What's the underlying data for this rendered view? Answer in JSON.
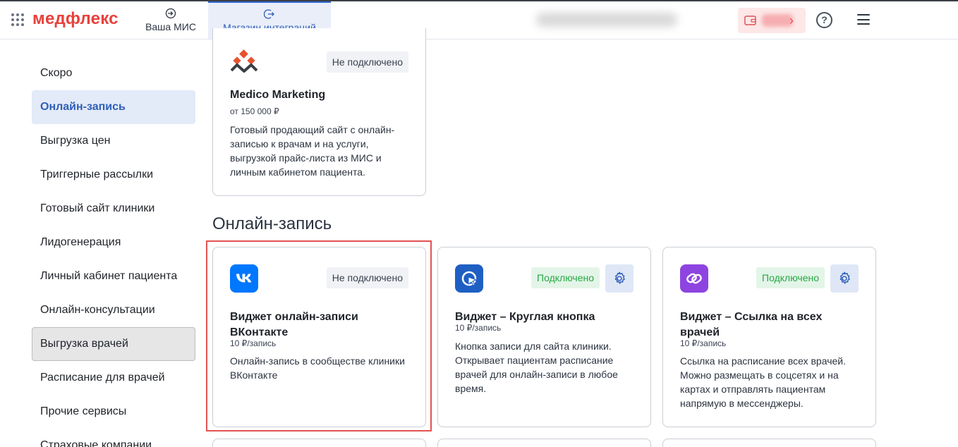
{
  "header": {
    "logo": "медфлекс",
    "tabs": [
      {
        "label": "Ваша МИС",
        "icon": "login-icon"
      },
      {
        "label": "Магазин интеграций",
        "icon": "logout-icon",
        "active": true
      }
    ]
  },
  "sidebar": {
    "items": [
      {
        "label": "Скоро"
      },
      {
        "label": "Онлайн-запись",
        "active": true
      },
      {
        "label": "Выгрузка цен"
      },
      {
        "label": "Триггерные рассылки"
      },
      {
        "label": "Готовый сайт клиники"
      },
      {
        "label": "Лидогенерация"
      },
      {
        "label": "Личный кабинет пациента"
      },
      {
        "label": "Онлайн-консультации"
      },
      {
        "label": "Выгрузка врачей",
        "hovered": true
      },
      {
        "label": "Расписание для врачей"
      },
      {
        "label": "Прочие сервисы"
      },
      {
        "label": "Страховые компании"
      }
    ]
  },
  "main": {
    "top_card": {
      "status": "Не подключено",
      "title": "Medico Marketing",
      "price": "от 150 000 ₽",
      "description": "Готовый продающий сайт с онлайн-записью к врачам и на услуги, выгрузкой прайс-листа из МИС и личным кабинетом пациента."
    },
    "section_title": "Онлайн-запись",
    "cards": [
      {
        "icon": "vk-icon",
        "status": "Не подключено",
        "title": "Виджет онлайн-записи ВКонтакте",
        "price": "10 ₽/запись",
        "description": "Онлайн-запись в сообществе клиники ВКонтакте"
      },
      {
        "icon": "cursor-click-icon",
        "status": "Подключено",
        "title": "Виджет – Круглая кнопка",
        "price": "10 ₽/запись",
        "description": "Кнопка записи для сайта клиники. Открывает пациентам расписание врачей для онлайн-записи в любое время."
      },
      {
        "icon": "link-icon",
        "status": "Подключено",
        "title": "Виджет – Ссылка на всех врачей",
        "price": "10 ₽/запись",
        "description": "Ссылка на расписание всех врачей. Можно размещать в соцсетях и на картах и отправлять пациентам напрямую в мессенджеры."
      }
    ]
  },
  "colors": {
    "brand": "#e8413c",
    "accent": "#2f5fb8",
    "connected": "#28a745",
    "vk": "#0077ff",
    "round_button": "#1f5fc4",
    "link": "#8e44e0",
    "medico_logo": "#e6532f"
  }
}
